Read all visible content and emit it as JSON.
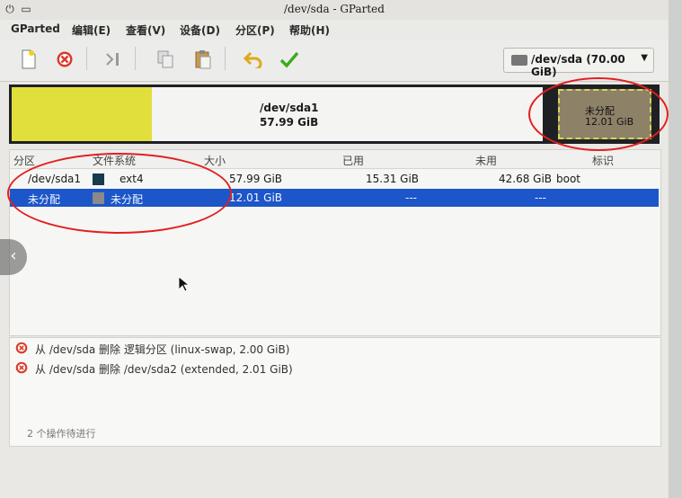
{
  "window": {
    "title": "/dev/sda - GParted"
  },
  "menu": [
    "GParted",
    "编辑(E)",
    "查看(V)",
    "设备(D)",
    "分区(P)",
    "帮助(H)"
  ],
  "toolbar": {
    "icons": [
      "new-icon",
      "delete-icon",
      "resize-icon",
      "copy-icon",
      "paste-icon",
      "undo-icon",
      "apply-icon"
    ],
    "device_label": "/dev/sda (70.00 GiB)"
  },
  "diskmap": {
    "partition": {
      "name": "/dev/sda1",
      "size": "57.99 GiB",
      "used_fraction": 0.264
    },
    "unallocated": {
      "name": "未分配",
      "size": "12.01 GiB"
    }
  },
  "table": {
    "headers": {
      "partition": "分区",
      "filesystem": "文件系统",
      "size": "大小",
      "used": "已用",
      "unused": "未用",
      "flags": "标识"
    },
    "rows": [
      {
        "partition": "/dev/sda1",
        "filesystem": "ext4",
        "size": "57.99 GiB",
        "used": "15.31 GiB",
        "unused": "42.68 GiB",
        "flags": "boot",
        "swatch": "#173a4f"
      },
      {
        "partition": "未分配",
        "filesystem": "未分配",
        "size": "12.01 GiB",
        "used": "---",
        "unused": "---",
        "flags": "",
        "swatch": "#8a8a8a"
      }
    ]
  },
  "log": {
    "items": [
      "从 /dev/sda 删除 逻辑分区 (linux-swap, 2.00 GiB)",
      "从 /dev/sda 删除 /dev/sda2 (extended, 2.01 GiB)"
    ],
    "status": "2 个操作待进行"
  },
  "colors": {
    "used": "#e1df3b",
    "unallocated": "#8d8168",
    "selection": "#1c56c9",
    "annotation": "#e21f1f"
  }
}
